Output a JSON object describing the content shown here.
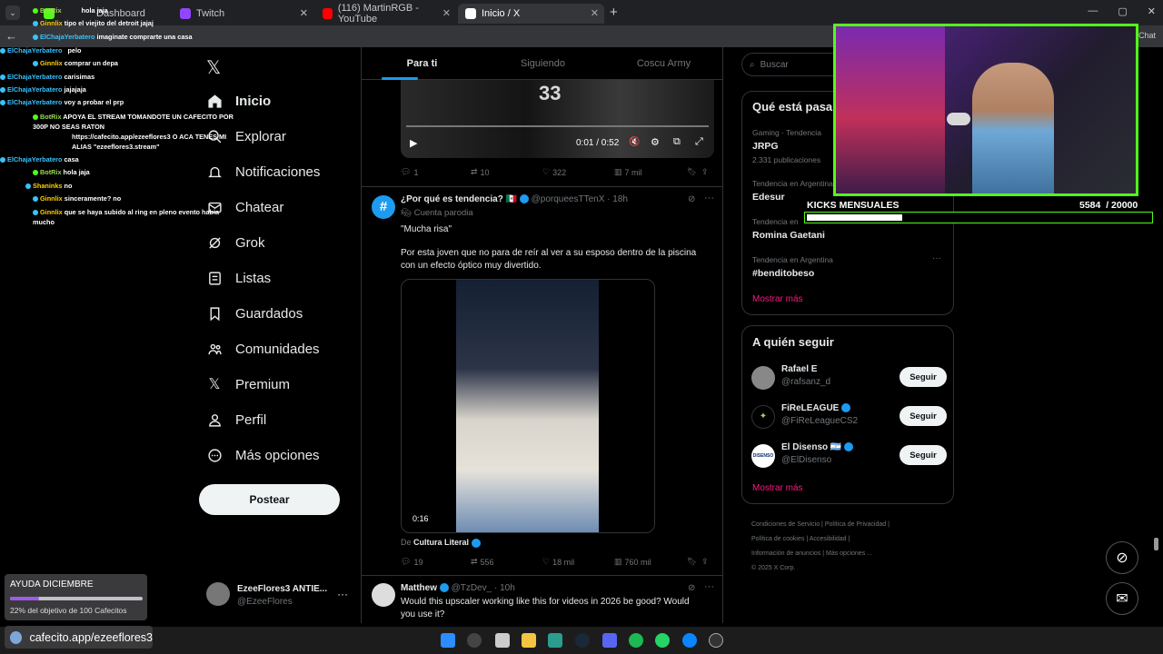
{
  "browser": {
    "tabs": [
      {
        "label": "Dashboard",
        "favicon_color": "#53fc18"
      },
      {
        "label": "Twitch",
        "favicon_color": "#9146ff"
      },
      {
        "label": "(116) MartinRGB - YouTube",
        "favicon_color": "#ff0000"
      },
      {
        "label": "Inicio / X",
        "favicon_color": "#ffffff"
      }
    ],
    "new_tab": "+",
    "chat_label": "Chat"
  },
  "chat": [
    {
      "user": "BotRix",
      "user_color": "#9ad84f",
      "text": "hola jaja"
    },
    {
      "user": "Ginnlix",
      "user_color": "#ffd000",
      "text": "tipo el viejito del detroit jajaj"
    },
    {
      "user": "ElChajaYerbatero",
      "user_color": "#38c3ff",
      "text": "imaginate comprarte una casa"
    },
    {
      "user": "ElChajaYerbatero",
      "user_color": "#38c3ff",
      "text": "pelo"
    },
    {
      "user": "Ginnlix",
      "user_color": "#ffd000",
      "text": "comprar un depa"
    },
    {
      "user": "ElChajaYerbatero",
      "user_color": "#38c3ff",
      "text": "carisimas"
    },
    {
      "user": "ElChajaYerbatero",
      "user_color": "#38c3ff",
      "text": "jajajaja"
    },
    {
      "user": "ElChajaYerbatero",
      "user_color": "#38c3ff",
      "text": "voy a probar el prp"
    },
    {
      "user": "BotRix",
      "user_color": "#9ad84f",
      "text": "APOYA EL STREAM TOMANDOTE UN CAFECITO POR 300P NO SEAS RATON"
    },
    {
      "user": "",
      "user_color": "#ffffff",
      "text": "https://cafecito.app/ezeeflores3 O ACA TENES MI ALIAS \"ezeeflores3.stream\""
    },
    {
      "user": "ElChajaYerbatero",
      "user_color": "#38c3ff",
      "text": "casa"
    },
    {
      "user": "BotRix",
      "user_color": "#9ad84f",
      "text": "hola jaja"
    },
    {
      "user": "Shaninks",
      "user_color": "#ffd000",
      "text": "no"
    },
    {
      "user": "Ginnlix",
      "user_color": "#ffd000",
      "text": "sinceramente? no"
    },
    {
      "user": "Ginnlix",
      "user_color": "#ffd000",
      "text": "que se haya subido al ring en pleno evento habia mucho"
    }
  ],
  "nav": [
    {
      "label": "Inicio",
      "icon": "home-icon"
    },
    {
      "label": "Explorar",
      "icon": "search-icon"
    },
    {
      "label": "Notificaciones",
      "icon": "bell-icon"
    },
    {
      "label": "Chatear",
      "icon": "mail-icon"
    },
    {
      "label": "Grok",
      "icon": "grok-icon"
    },
    {
      "label": "Listas",
      "icon": "list-icon"
    },
    {
      "label": "Guardados",
      "icon": "bookmark-icon"
    },
    {
      "label": "Comunidades",
      "icon": "communities-icon"
    },
    {
      "label": "Premium",
      "icon": "x-logo-icon"
    },
    {
      "label": "Perfil",
      "icon": "person-icon"
    },
    {
      "label": "Más opciones",
      "icon": "more-icon"
    }
  ],
  "post_button": "Postear",
  "account": {
    "name": "EzeeFlores3 ANTIE...",
    "handle": "@EzeeFlores",
    "more": "···"
  },
  "feed": {
    "tabs": [
      "Para ti",
      "Siguiendo",
      "Coscu Army"
    ],
    "video1": {
      "time": "0:01 / 0:52",
      "jersey": "33"
    },
    "video1_actions": {
      "replies": "1",
      "reposts": "10",
      "likes": "322",
      "views": "7 mil"
    },
    "tweet2": {
      "author": "¿Por qué es tendencia?",
      "flag": "🇲🇽",
      "handle": "@porqueesTTenX",
      "time": "18h",
      "tag": "Cuenta parodia",
      "text1": "\"Mucha risa\"",
      "text2": "Por esta joven que no para de reír al ver a su esposo dentro de la piscina con un efecto óptico muy divertido.",
      "duration": "0:16",
      "source_prefix": "De",
      "source": "Cultura Literal",
      "actions": {
        "replies": "19",
        "reposts": "556",
        "likes": "18 mil",
        "views": "760 mil"
      }
    },
    "tweet3": {
      "author": "Matthew",
      "handle": "@TzDev_",
      "time": "10h",
      "text": "Would this upscaler working like this for videos in 2026 be good? Would you use it?"
    }
  },
  "sidebar": {
    "search_placeholder": "Buscar",
    "trends_title": "Qué está pasa",
    "trends": [
      {
        "meta": "Gaming · Tendencia",
        "name": "JRPG",
        "count": "2.331 publicaciones"
      },
      {
        "meta": "Tendencia en Argentina",
        "name": "Edesur",
        "count": ""
      },
      {
        "meta": "Tendencia en",
        "name": "Romina Gaetani",
        "count": ""
      },
      {
        "meta": "Tendencia en Argentina",
        "name": "#benditobeso",
        "count": ""
      }
    ],
    "show_more": "Mostrar más",
    "follow_title": "A quién seguir",
    "follow": [
      {
        "name": "Rafael E",
        "handle": "@rafsanz_d",
        "verified": false,
        "button": "Seguir"
      },
      {
        "name": "FiReLEAGUE",
        "handle": "@FiReLeagueCS2",
        "verified": true,
        "button": "Seguir"
      },
      {
        "name": "El Disenso 🇦🇷",
        "handle": "@ElDisenso",
        "verified": true,
        "button": "Seguir",
        "avatar_text": "DISENSO"
      }
    ],
    "footer": [
      "Condiciones de Servicio",
      "Política de Privacidad",
      "Política de cookies",
      "Accesibilidad",
      "Información de anuncios",
      "Más opciones ...",
      "© 2025 X Corp."
    ]
  },
  "stream": {
    "kicks_label": "KICKS MENSUALES",
    "kicks_current": "5584",
    "kicks_goal": "/ 20000",
    "kicks_fraction": 0.279,
    "donation_title": "AYUDA DICIEMBRE",
    "donation_text": "22% del objetivo de 100 Cafecitos",
    "donation_fraction": 0.22,
    "cafecito_url": "cafecito.app/ezeeflores3"
  },
  "colors": {
    "accent": "#1d9bf0",
    "kick_green": "#53fc18",
    "background": "#000000",
    "border": "#2f3336",
    "muted": "#71767b"
  }
}
